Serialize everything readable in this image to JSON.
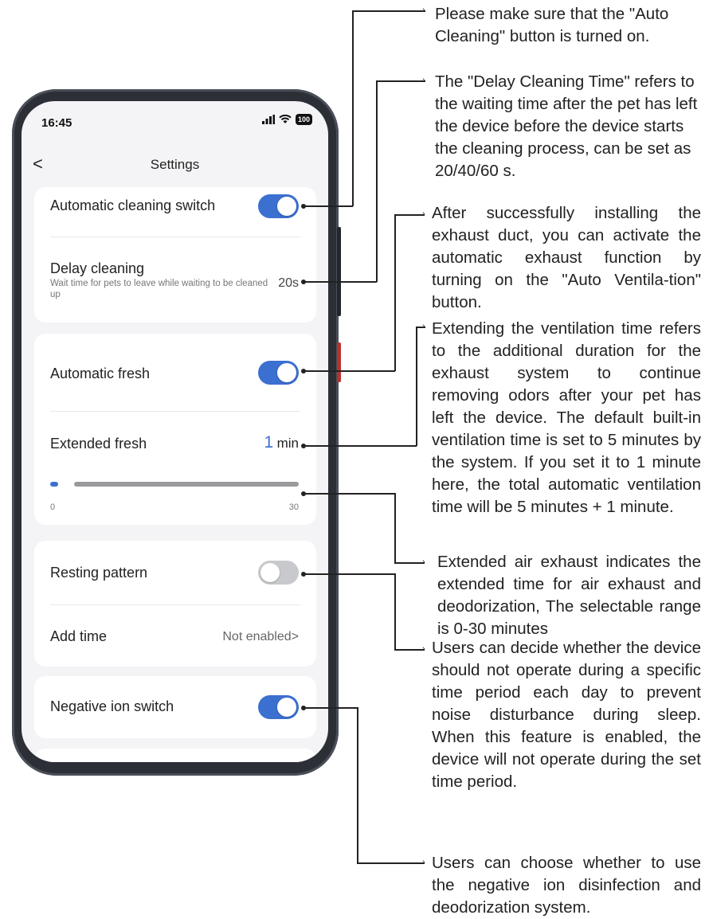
{
  "status_bar": {
    "time": "16:45",
    "signal": ".ıl",
    "wifi": "wifi-icon",
    "battery": "100"
  },
  "nav": {
    "back": "<",
    "title": "Settings"
  },
  "card1": {
    "auto_clean_label": "Automatic cleaning switch",
    "auto_clean_on": true,
    "delay_label": "Delay cleaning",
    "delay_sub": "Wait time for pets to leave while waiting to be cleaned up",
    "delay_value": "20s"
  },
  "card2": {
    "auto_fresh_label": "Automatic fresh",
    "auto_fresh_on": true,
    "extended_label": "Extended fresh",
    "extended_value": "1",
    "extended_unit": "min",
    "slider_min": "0",
    "slider_max": "30",
    "slider_value": 1
  },
  "card3": {
    "resting_label": "Resting pattern",
    "resting_on": false,
    "add_time_label": "Add time",
    "add_time_value": "Not enabled>"
  },
  "card4": {
    "ion_label": "Negative ion switch",
    "ion_on": true
  },
  "notes": {
    "n1": "Please make sure that the \"Auto Cleaning\" button is turned on.",
    "n2": "The \"Delay Cleaning Time\" refers to the waiting time after the pet has left the device before the device starts the cleaning process, can be set as 20/40/60 s.",
    "n3": "After successfully installing the exhaust duct, you can activate the automatic exhaust function by turning on the \"Auto Ventila-tion\" button.",
    "n4": "Extending the ventilation time refers to the additional duration for the exhaust system to continue removing odors after your pet has left the device. The default built-in ventilation time is set to 5 minutes by the system. If you set it to 1 minute here, the total automatic ventilation time will be 5 minutes + 1 minute.",
    "n5": "Extended air exhaust indicates the extended time for air exhaust and deodorization, The selectable range is 0-30 minutes",
    "n6": "Users can decide whether the device should not operate during a specific time period each day to prevent noise disturbance during sleep. When this feature is enabled, the device will not operate during the set time period.",
    "n7": "Users can choose whether to use the negative ion disinfection and deodorization system."
  }
}
